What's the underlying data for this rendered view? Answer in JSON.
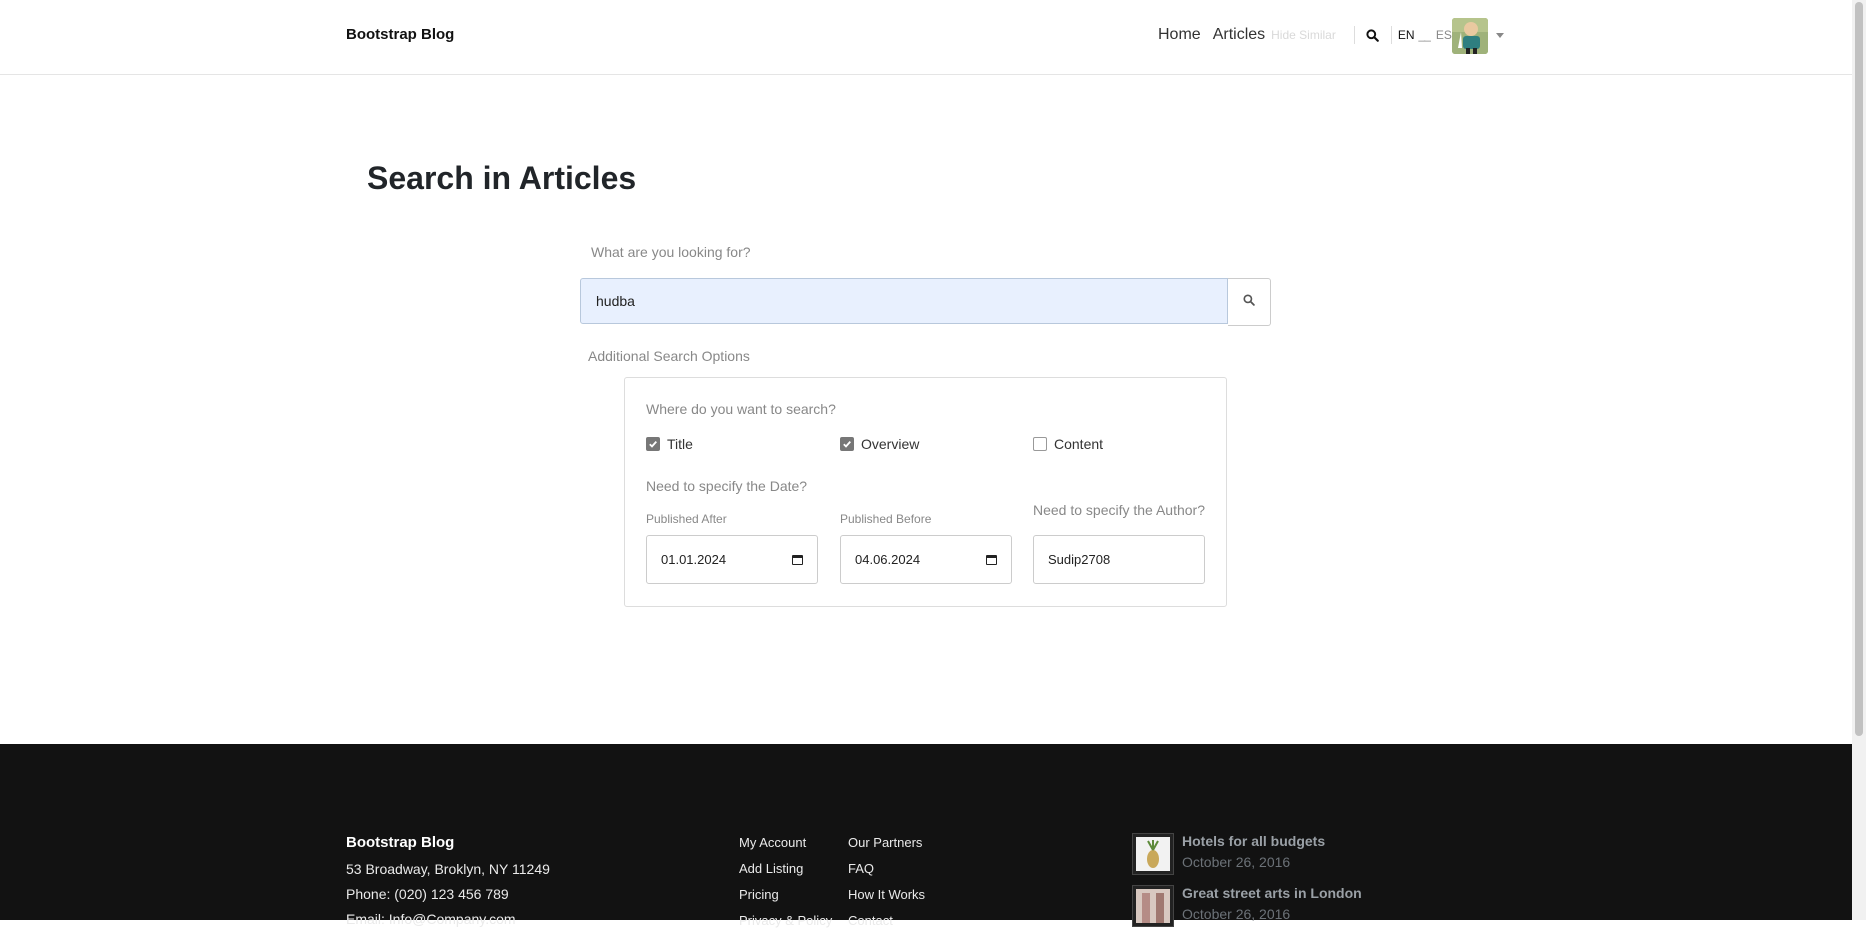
{
  "header": {
    "brand": "Bootstrap Blog",
    "nav": [
      "Home",
      "Articles"
    ],
    "hidden_link": "Hide Similar",
    "lang_active": "EN",
    "lang_sep": "__",
    "lang_other": "ES"
  },
  "main": {
    "title": "Search in Articles",
    "search_label": "What are you looking for?",
    "search_value": "hudba",
    "additional_label": "Additional Search Options",
    "where_label": "Where do you want to search?",
    "checkboxes": [
      {
        "label": "Title",
        "checked": true
      },
      {
        "label": "Overview",
        "checked": true
      },
      {
        "label": "Content",
        "checked": false
      }
    ],
    "date_label": "Need to specify the Date?",
    "published_after_label": "Published After",
    "published_after_value": "01.01.2024",
    "published_before_label": "Published Before",
    "published_before_value": "04.06.2024",
    "author_label": "Need to specify the Author?",
    "author_value": "Sudip2708"
  },
  "footer": {
    "brand": "Bootstrap Blog",
    "address": "53 Broadway, Broklyn, NY 11249",
    "phone": "Phone: (020) 123 456 789",
    "email": "Email: Info@Company.com",
    "links_col1": [
      "My Account",
      "Add Listing",
      "Pricing",
      "Privacy & Policy"
    ],
    "links_col2": [
      "Our Partners",
      "FAQ",
      "How It Works",
      "Contact"
    ],
    "posts": [
      {
        "title": "Hotels for all budgets",
        "date": "October 26, 2016"
      },
      {
        "title": "Great street arts in London",
        "date": "October 26, 2016"
      }
    ]
  },
  "colors": {
    "footer_bg": "#121212",
    "input_bg": "#e8f0fe"
  },
  "icons": [
    "search-icon",
    "calendar-icon",
    "check-icon",
    "caret-down-icon"
  ]
}
